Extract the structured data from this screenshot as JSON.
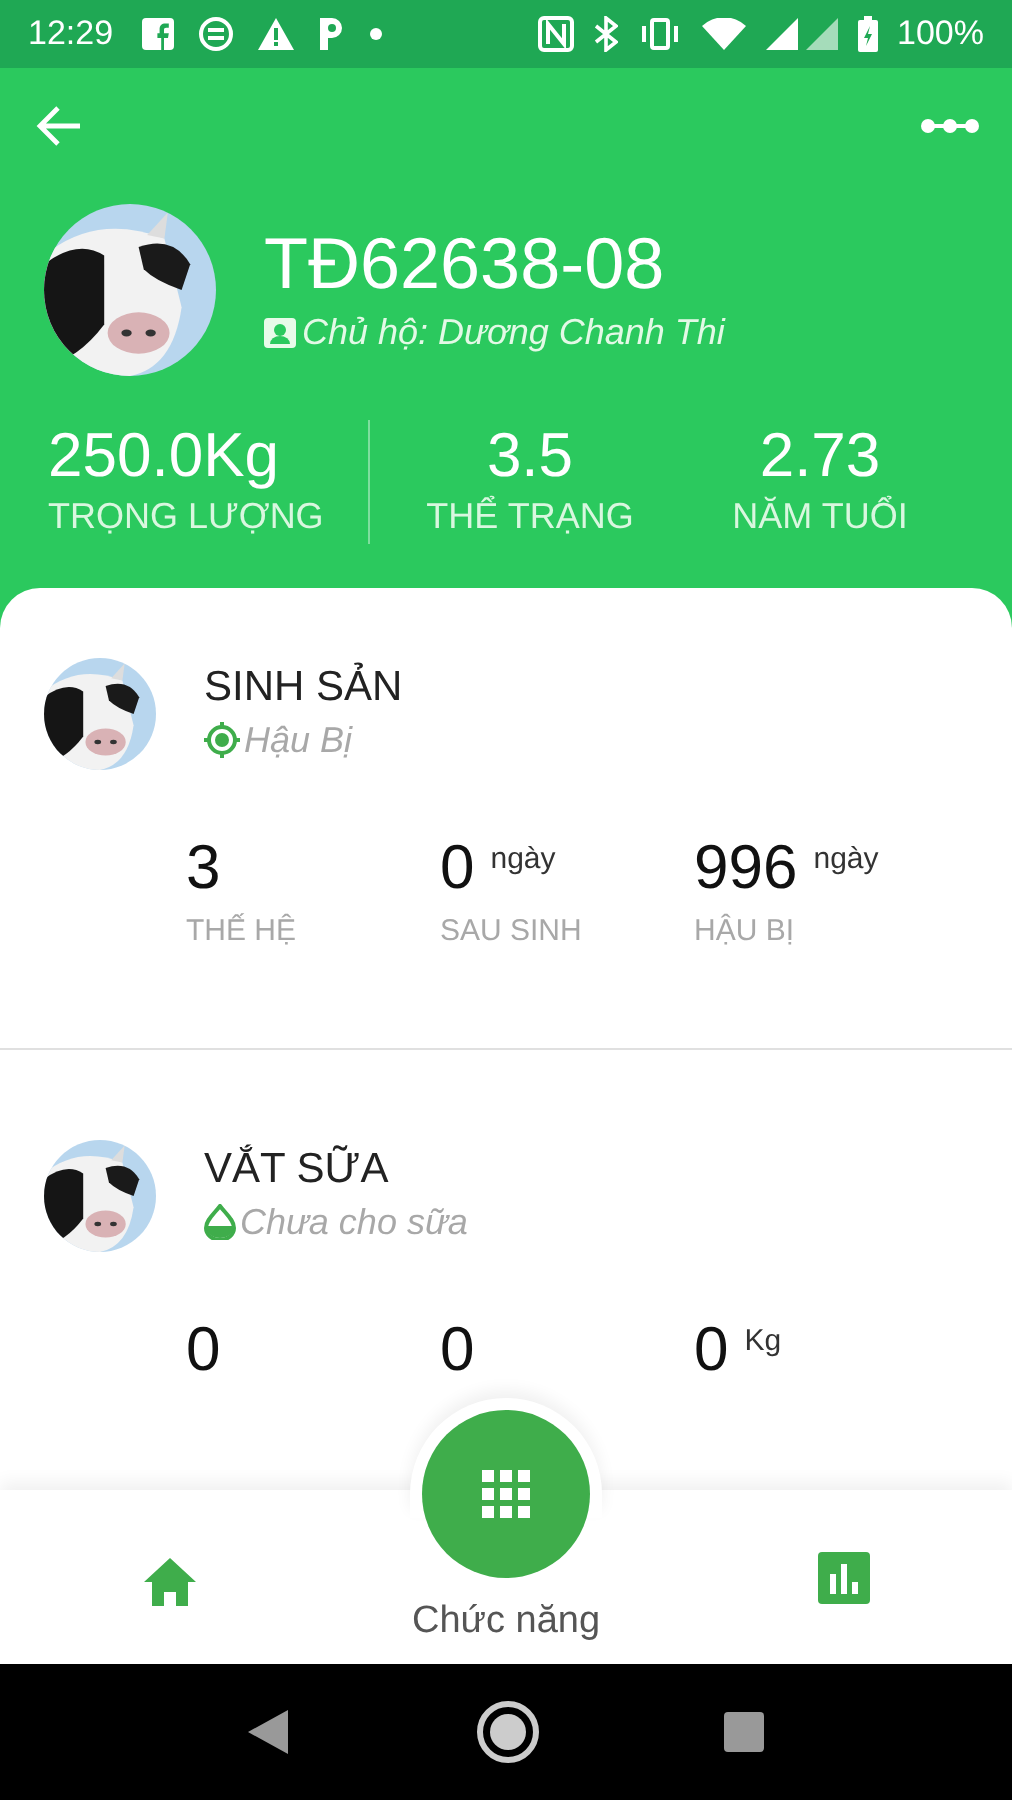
{
  "status_bar": {
    "time": "12:29",
    "battery": "100%"
  },
  "header": {
    "title": "TĐ62638-08",
    "owner": "Chủ hộ: Dương Chanh Thi",
    "stats": [
      {
        "value": "250.0Kg",
        "label": "TRỌNG LƯỢNG"
      },
      {
        "value": "3.5",
        "label": "THỂ TRẠNG"
      },
      {
        "value": "2.73",
        "label": "NĂM TUỔI"
      }
    ]
  },
  "sections": [
    {
      "title": "SINH SẢN",
      "status": "Hậu Bị",
      "kind": "target",
      "stats": [
        {
          "value": "3",
          "label": "THẾ HỆ"
        },
        {
          "value": "0",
          "unit": "ngày",
          "label": "SAU SINH"
        },
        {
          "value": "996",
          "unit": "ngày",
          "label": "HẬU BỊ"
        }
      ]
    },
    {
      "title": "VẮT SỮA",
      "status": "Chưa cho sữa",
      "kind": "drop",
      "stats": [
        {
          "value": "0"
        },
        {
          "value": "0"
        },
        {
          "value": "0",
          "unit": "Kg"
        }
      ]
    }
  ],
  "bottom_nav": {
    "center_label": "Chức năng"
  }
}
